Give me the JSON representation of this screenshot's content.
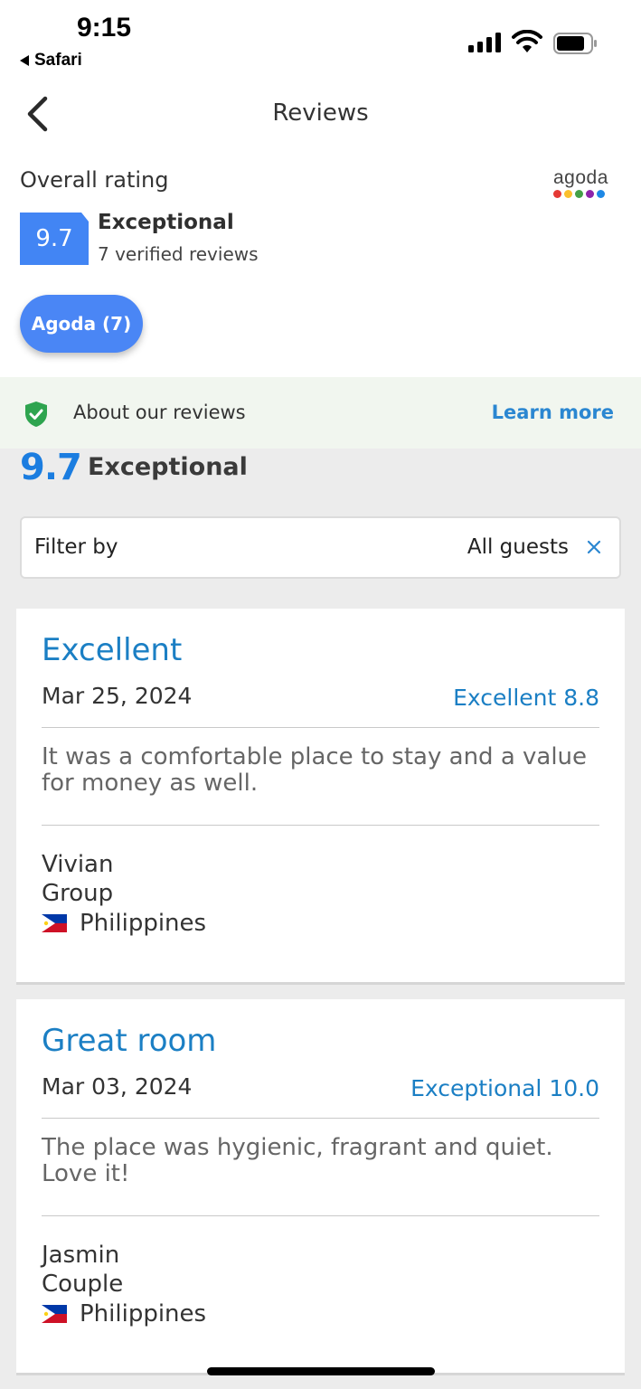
{
  "status_bar": {
    "time": "9:15",
    "back_app": "Safari"
  },
  "nav": {
    "title": "Reviews"
  },
  "overall": {
    "label": "Overall rating",
    "brand": "agoda",
    "score": "9.7",
    "rating_word": "Exceptional",
    "review_count": "7 verified reviews",
    "source_pill": "Agoda (7)"
  },
  "about": {
    "text": "About our reviews",
    "link": "Learn more"
  },
  "summary": {
    "score": "9.7",
    "word": "Exceptional"
  },
  "filter": {
    "label": "Filter by",
    "value": "All guests"
  },
  "reviews": [
    {
      "title": "Excellent",
      "date": "Mar 25, 2024",
      "score": "Excellent 8.8",
      "body": "It was a comfortable place to stay and a value for money as well.",
      "name": "Vivian",
      "traveler_type": "Group",
      "country": "Philippines"
    },
    {
      "title": "Great room",
      "date": "Mar 03, 2024",
      "score": "Exceptional 10.0",
      "body": "The place was hygienic, fragrant and quiet. Love it!",
      "name": "Jasmin",
      "traveler_type": "Couple",
      "country": "Philippines"
    }
  ],
  "colors": {
    "accent_blue": "#4285f4",
    "link_blue": "#1b7fc4",
    "about_bg": "#f1f6ef",
    "shield_green": "#2ea44f",
    "logo_dots": [
      "#e53935",
      "#fbc02d",
      "#43a047",
      "#8e24aa",
      "#1e88e5"
    ]
  }
}
